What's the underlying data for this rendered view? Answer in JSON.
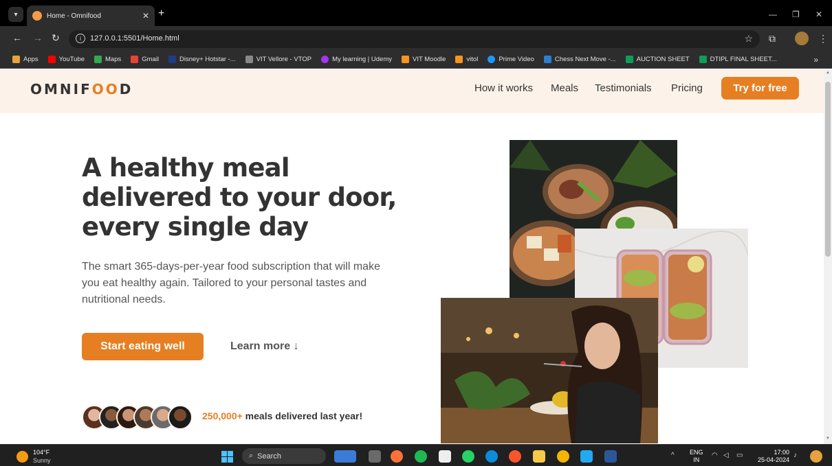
{
  "browser": {
    "tab_title": "Home - Omnifood",
    "url": "127.0.0.1:5501/Home.html",
    "bookmarks": [
      "Apps",
      "YouTube",
      "Maps",
      "Gmail",
      "Disney+ Hotstar -...",
      "VIT Vellore - VTOP",
      "My learning | Udemy",
      "VIT Moodle",
      "vitol",
      "Prime Video",
      "Chess Next Move -...",
      "AUCTION SHEET",
      "DTIPL FINAL SHEET..."
    ],
    "bookmark_colors": [
      "#e8a33c",
      "#ff0000",
      "#34a853",
      "#ea4335",
      "#1f3c88",
      "#888888",
      "#a435f0",
      "#f7941d",
      "#f7941d",
      "#1a98ff",
      "#2d7dd2",
      "#0f9d58",
      "#0f9d58"
    ]
  },
  "site": {
    "logo_left": "OMNIF",
    "logo_oo": "OO",
    "logo_right": "D",
    "nav": [
      "How it works",
      "Meals",
      "Testimonials",
      "Pricing"
    ],
    "cta_nav": "Try for free",
    "hero_title": "A healthy meal delivered to your door, every single day",
    "hero_desc": "The smart 365-days-per-year food subscription that will make you eat healthy again. Tailored to your personal tastes and nutritional needs.",
    "btn_primary": "Start eating well",
    "btn_secondary": "Learn more ↓",
    "delivered_num": "250,000+",
    "delivered_text": " meals delivered last year!",
    "accent_color": "#e67e22",
    "header_bg": "#fdf2e9"
  },
  "taskbar": {
    "temp": "104°F",
    "weather": "Sunny",
    "search": "Search",
    "lang_1": "ENG",
    "lang_2": "IN",
    "time": "17:00",
    "date": "25-04-2024"
  }
}
